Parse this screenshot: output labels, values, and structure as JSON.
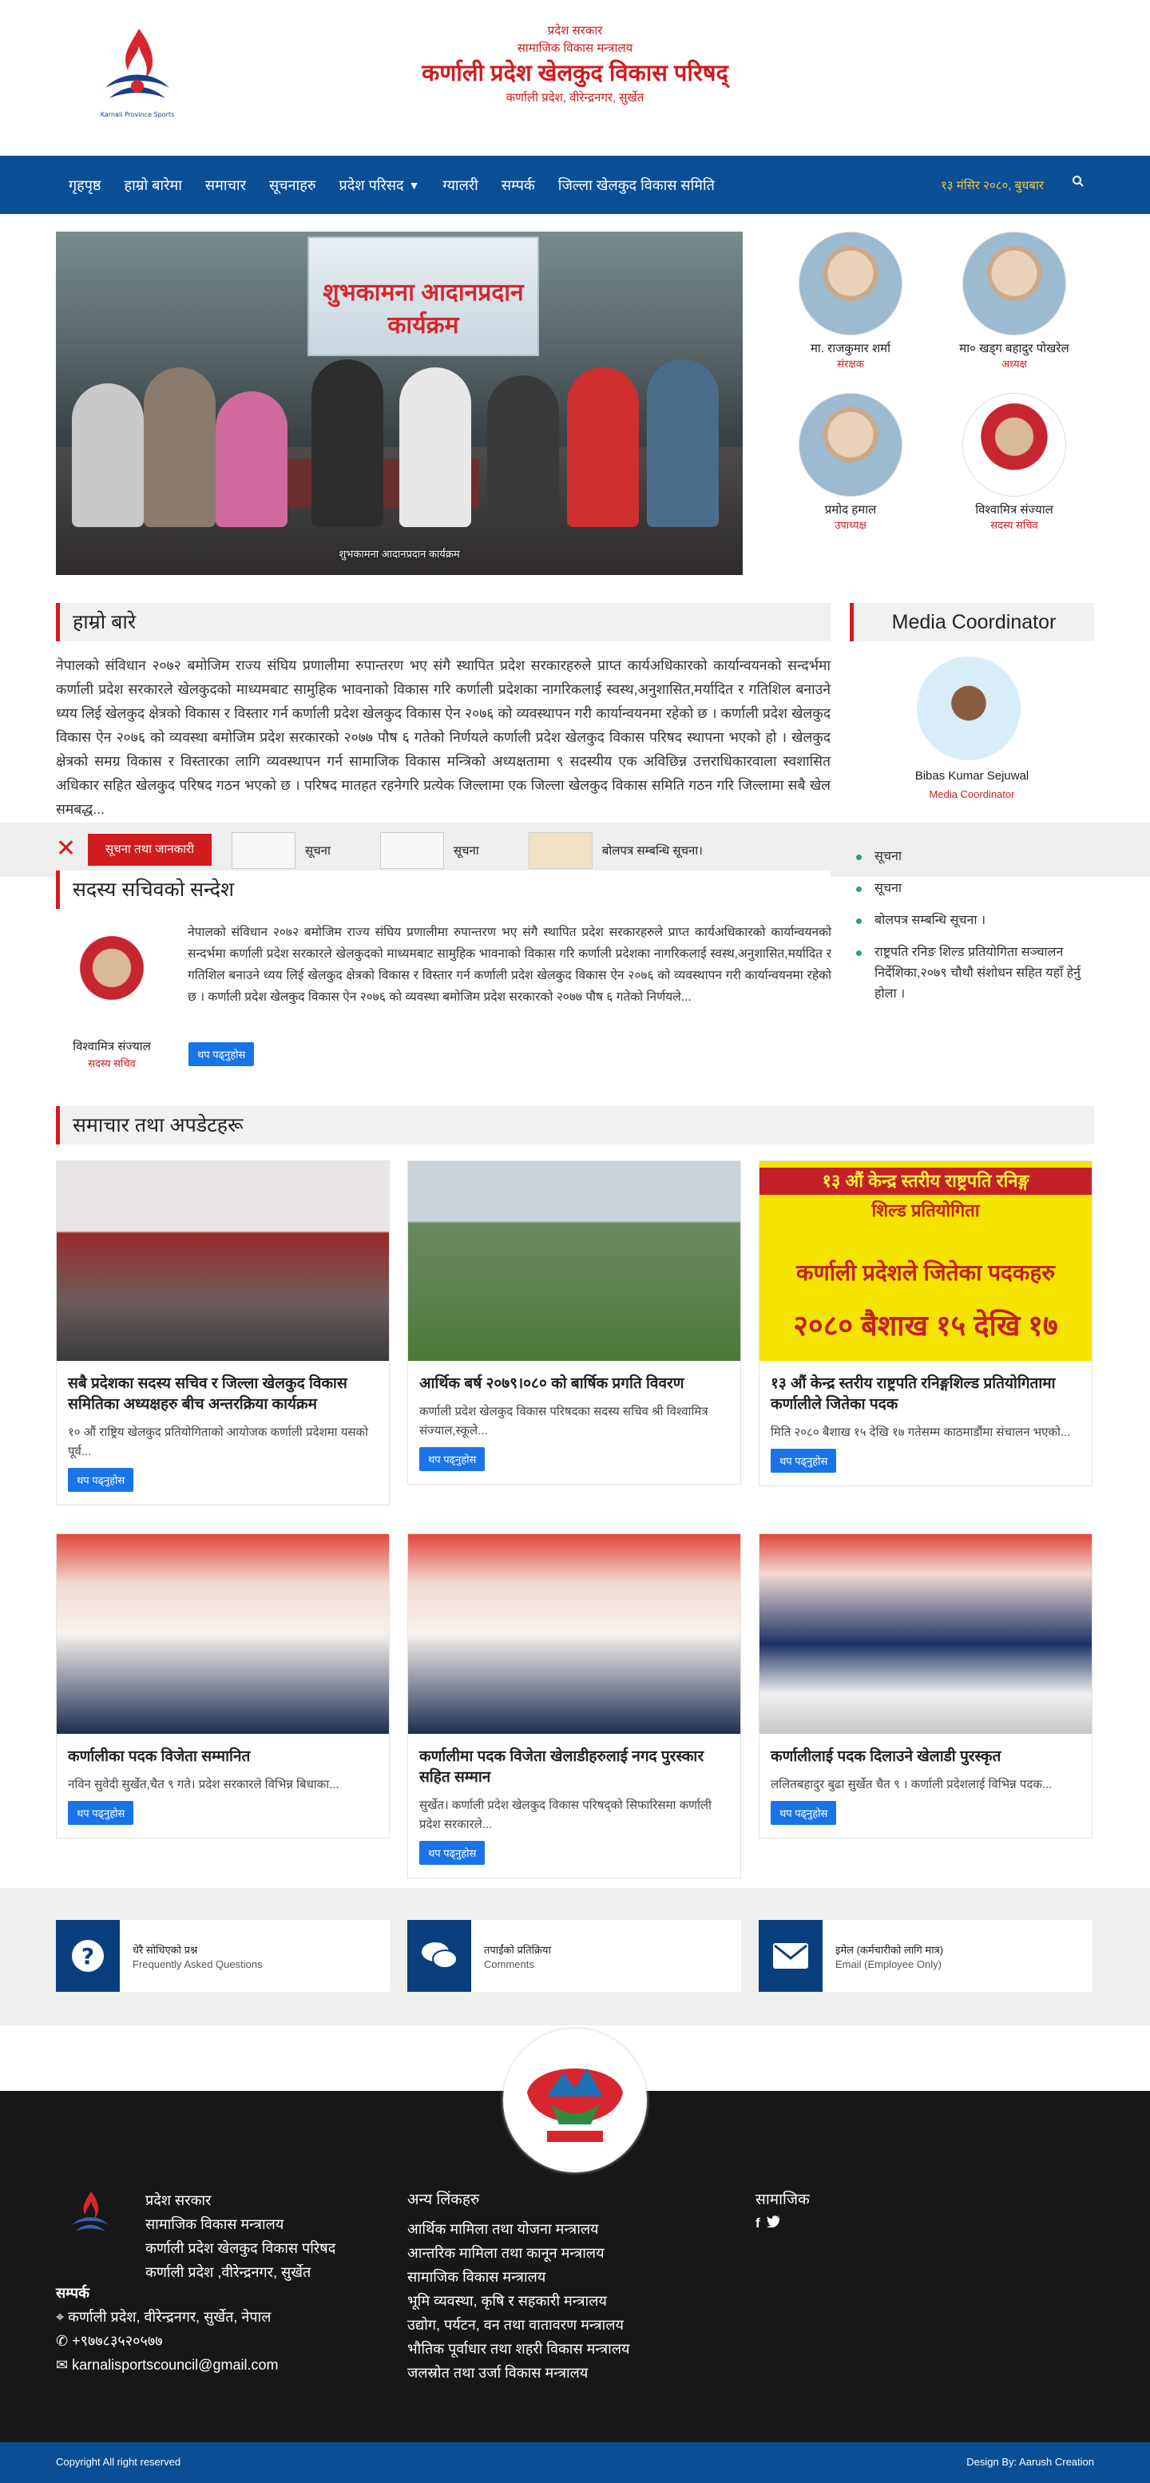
{
  "header": {
    "line1": "प्रदेश सरकार",
    "line2": "सामाजिक विकास मन्त्रालय",
    "title": "कर्णाली प्रदेश खेलकुद विकास परिषद्",
    "address": "कर्णाली प्रदेश, वीरेन्द्रनगर, सुर्खेत",
    "logo_icon": "council-logo-icon"
  },
  "nav": {
    "items": [
      "गृहपृष्ठ",
      "हाम्रो बारेमा",
      "समाचार",
      "सूचनाहरु",
      "प्रदेश परिसद",
      "ग्यालरी",
      "सम्पर्क",
      "जिल्ला खेलकुद विकास समिति"
    ],
    "date": "१३ मंसिर २०८०, बुधबार",
    "search_icon": "search-icon"
  },
  "hero": {
    "banner_text": "शुभकामना आदानप्रदान कार्यक्रम",
    "caption": "शुभकामना आदानप्रदान कार्यक्रम"
  },
  "officials": [
    {
      "name": "मा. राजकुमार शर्मा",
      "role": "संरक्षक"
    },
    {
      "name": "मा० खड्ग बहादुर पोखरेल",
      "role": "अध्यक्ष"
    },
    {
      "name": "प्रमोद हमाल",
      "role": "उपाध्यक्ष"
    },
    {
      "name": "विश्वामित्र संज्याल",
      "role": "सदस्य सचिव"
    }
  ],
  "about": {
    "title": "हाम्रो बारे",
    "text": "नेपालको संविधान २०७२ बमोजिम राज्य संघिय प्रणालीमा रुपान्तरण भए संगै स्थापित प्रदेश सरकारहरुले प्राप्त कार्यअधिकारको कार्यान्वयनको सन्दर्भमा कर्णाली प्रदेश सरकारले खेलकुदको माध्यमबाट सामुहिक भावनाको विकास गरि कर्णाली प्रदेशका नागरिकलाई स्वस्थ,अनुशासित,मर्यादित र गतिशिल बनाउने ध्यय लिई खेलकुद क्षेत्रको विकास र विस्तार गर्न कर्णाली प्रदेश खेलकुद विकास ऐन २०७६ को व्यवस्थापन गरी कार्यान्वयनमा रहेको छ । कर्णाली प्रदेश खेलकुद विकास ऐन २०७६ को व्यवस्था बमोजिम प्रदेश सरकारको २०७७ पौष ६ गतेको निर्णयले कर्णाली प्रदेश खेलकुद विकास परिषद स्थापना भएको हो । खेलकुद क्षेत्रको समग्र विकास र विस्तारका लागि व्यवस्थापन गर्न सामाजिक विकास मन्त्रिको अध्यक्षतामा ९ सदस्यीय एक अविछिन्न उत्तराधिकारवाला स्वशासित अधिकार सहित खेलकुद परिषद गठन भएको छ । परिषद मातहत रहनेगरि प्रत्येक जिल्लामा एक जिल्ला खेलकुद विकास समिति गठन गरि जिल्लामा सबै खेल समबद्ध..."
  },
  "media_coordinator": {
    "title": "Media Coordinator",
    "name": "Bibas Kumar Sejuwal",
    "role": "Media Coordinator"
  },
  "ticker": {
    "close_icon": "close-icon",
    "label": "सूचना तथा जानकारी",
    "items": [
      "सूचना",
      "सूचना",
      "बोलपत्र सम्बन्धि सूचना।"
    ]
  },
  "notices": [
    "सूचना",
    "सूचना",
    "बोलपत्र सम्बन्धि सूचना ।",
    "राष्ट्रपति रनिङ शिल्ड प्रतियोगिता सञ्चालन निर्देशिका,२०७९ चौथौ संशोधन सहित यहाँ हेर्नु होला ।"
  ],
  "secretary": {
    "title": "सदस्य सचिवको सन्देश",
    "name": "विश्वामित्र संज्याल",
    "role": "सदस्य सचिव",
    "text": "नेपालको संविधान २०७२ बमोजिम राज्य संघिय प्रणालीमा रुपान्तरण भए संगै स्थापित प्रदेश सरकारहरुले प्राप्त कार्यअधिकारको कार्यान्वयनको सन्दर्भमा कर्णाली प्रदेश सरकारले खेलकुदको माध्यमबाट सामुहिक भावनाको विकास गरि कर्णाली प्रदेशका नागरिकलाई स्वस्थ,अनुशासित,मर्यादित र गतिशिल बनाउने ध्यय लिई खेलकुद क्षेत्रको विकास र विस्तार गर्न कर्णाली प्रदेश खेलकुद विकास ऐन २०७६ को व्यवस्थापन गरी कार्यान्वयनमा रहेको छ । कर्णाली प्रदेश खेलकुद विकास ऐन २०७६ को व्यवस्था बमोजिम प्रदेश सरकारको २०७७ पौष ६ गतेको निर्णयले...",
    "button": "थप पढ्नुहोस"
  },
  "news": {
    "title": "समाचार तथा अपडेटहरू",
    "read_more": "थप पढ्नुहोस",
    "cards": [
      {
        "title": "सबै प्रदेशका सदस्य सचिव र जिल्ला खेलकुद विकास समितिका अध्यक्षहरु बीच अन्तरक्रिया कार्यक्रम",
        "desc": "१० औं राष्ट्रिय खेलकुद प्रतियोगिताको आयोजक कर्णाली प्रदेशमा यसको पूर्व..."
      },
      {
        "title": "आर्थिक बर्ष २०७९।०८० को बार्षिक प्रगति विवरण",
        "desc": "कर्णाली प्रदेश खेलकुद विकास परिषदका सदस्य सचिव श्री विश्वामित्र संज्याल,स्कूले..."
      },
      {
        "title": "१३ औं केन्द्र स्तरीय राष्ट्रपति रनिङ्गशिल्ड प्रतियोगितामा कर्णालीले जितेका पदक",
        "desc": "मिति २०८० बैशाख १५ देखि १७ गतेसम्म काठमाडौंमा संचालन भएको..."
      },
      {
        "title": "कर्णालीका पदक विजेता सम्मानित",
        "desc": "नविन सुवेदी सुर्खेत,चैत ९ गते। प्रदेश सरकारले विभिन्न बिधाका..."
      },
      {
        "title": "कर्णालीमा पदक विजेता खेलाडीहरुलाई नगद पुरस्कार सहित सम्मान",
        "desc": "सुर्खेत। कर्णाली प्रदेश खेलकुद विकास परिषद्को सिफारिसमा कर्णाली प्रदेश सरकारले..."
      },
      {
        "title": "कर्णालीलाई पदक दिलाउने खेलाडी पुरस्कृत",
        "desc": "ललितबहादुर बुढा सुर्खेत चैत ९ । कर्णाली प्रदेशलाई विभिन्न पदक..."
      }
    ],
    "card3_banner": {
      "line1": "१३ औं केन्द्र स्तरीय राष्ट्रपति रनिङ्ग",
      "line2": "शिल्ड प्रतियोगिता",
      "line3": "कर्णाली प्रदेशले जितेका पदकहरु",
      "line4": "२०८० बैशाख १५ देखि १७"
    }
  },
  "quick_links": [
    {
      "icon": "question-icon",
      "title": "धेरै सोधिएको प्रश्न",
      "sub": "Frequently Asked Questions"
    },
    {
      "icon": "comments-icon",
      "title": "तपाईंको प्रतिक्रिया",
      "sub": "Comments"
    },
    {
      "icon": "envelope-icon",
      "title": "इमेल (कर्मचारीको लागि मात्र)",
      "sub": "Email (Employee Only)"
    }
  ],
  "footer": {
    "org": [
      "प्रदेश सरकार",
      "सामाजिक विकास मन्त्रालय",
      "कर्णाली प्रदेश खेलकुद विकास परिषद",
      "कर्णाली प्रदेश ,वीरेन्द्रनगर, सुर्खेत"
    ],
    "contact_title": "सम्पर्क",
    "address": "कर्णाली प्रदेश, वीरेन्द्रनगर, सुर्खेत, नेपाल",
    "phone": "+९७७८३५२०५७७",
    "email": "karnalisportscouncil@gmail.com",
    "links_title": "अन्य लिंकहरु",
    "links": [
      "आर्थिक मामिला तथा योजना मन्त्रालय",
      "आन्तरिक मामिला तथा कानून मन्त्रालय",
      "सामाजिक विकास मन्त्रालय",
      "भूमि व्यवस्था, कृषि र सहकारी मन्त्रालय",
      "उद्योग, पर्यटन, वन तथा वातावरण मन्त्रालय",
      "भौतिक पूर्वाधार तथा शहरी विकास मन्त्रालय",
      "जलस्रोत तथा उर्जा विकास मन्त्रालय"
    ],
    "social_title": "सामाजिक",
    "copyright": "Copyright All right reserved",
    "design": "Design By: Aarush Creation"
  },
  "colors": {
    "primary_blue": "#0a4f96",
    "accent_red": "#d01c1f",
    "button_blue": "#1a74e8",
    "footer_bg": "#171717"
  }
}
